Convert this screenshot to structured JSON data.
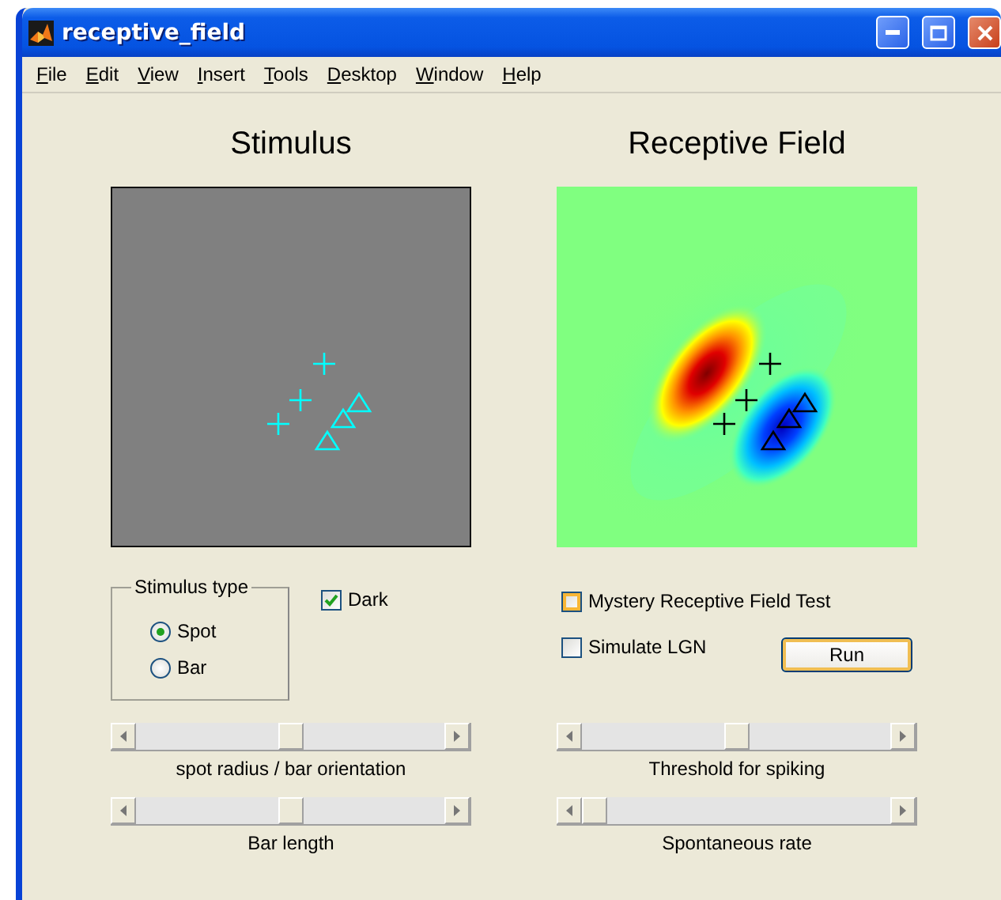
{
  "window": {
    "title": "receptive_field"
  },
  "menu": [
    "File",
    "Edit",
    "View",
    "Insert",
    "Tools",
    "Desktop",
    "Window",
    "Help"
  ],
  "stimulus_plot": {
    "title": "Stimulus"
  },
  "rf_plot": {
    "title": "Receptive Field"
  },
  "stimulus_type": {
    "label": "Stimulus type",
    "options": [
      {
        "label": "Spot",
        "selected": true
      },
      {
        "label": "Bar",
        "selected": false
      }
    ]
  },
  "dark": {
    "label": "Dark",
    "checked": true
  },
  "mystery": {
    "label": "Mystery Receptive Field Test",
    "checked": false,
    "hovered": true
  },
  "simulate_lgn": {
    "label": "Simulate LGN",
    "checked": false,
    "hovered": false
  },
  "run_button": {
    "label": "Run"
  },
  "left_sliders": [
    {
      "label": "spot radius / bar orientation",
      "level": 0.5
    },
    {
      "label": "Bar length",
      "level": 0.5
    }
  ],
  "right_sliders": [
    {
      "label": "Threshold for spiking",
      "level": 0.5
    },
    {
      "label": "Spontaneous rate",
      "level": 0
    }
  ]
}
